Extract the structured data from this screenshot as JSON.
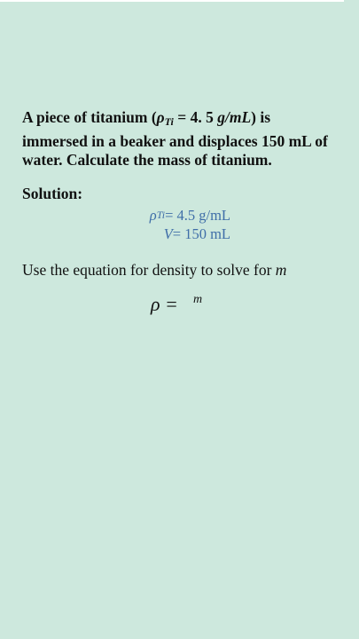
{
  "problem": {
    "prefix": "A piece of titanium (",
    "rho_symbol": "ρ",
    "rho_subscript": "Ti",
    "density_expr": " = 4. 5 ",
    "density_unit": "g/mL",
    "line1_end": ") is",
    "line2": "immersed in a beaker and displaces 150 mL of",
    "line3": "water. Calculate the mass of titanium."
  },
  "solution": {
    "label": "Solution:",
    "given": [
      {
        "lhs": "ρ",
        "sub": "Ti",
        "rhs": " = 4.5 g/mL"
      },
      {
        "lhs": "V",
        "sub": "",
        "rhs": " = 150 mL"
      }
    ]
  },
  "instruction": {
    "text": "Use the equation for density to solve for ",
    "variable": "m"
  },
  "equation": {
    "lhs": "ρ =",
    "numerator": "m"
  },
  "colors": {
    "background": "#cde8dd",
    "given_text": "#3f6ea8"
  }
}
